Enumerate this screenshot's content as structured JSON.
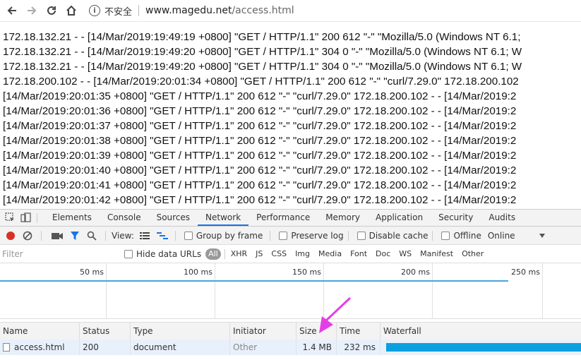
{
  "browser": {
    "security_text": "不安全",
    "url_host": "www.magedu.net",
    "url_path": "/access.html",
    "icons": [
      "back-arrow-icon",
      "forward-arrow-icon",
      "reload-icon",
      "home-icon",
      "info-icon"
    ]
  },
  "page": {
    "log_lines": [
      "172.18.132.21 - - [14/Mar/2019:19:49:19 +0800] \"GET / HTTP/1.1\" 200 612 \"-\" \"Mozilla/5.0 (Windows NT 6.1;",
      "172.18.132.21 - - [14/Mar/2019:19:49:20 +0800] \"GET / HTTP/1.1\" 304 0 \"-\" \"Mozilla/5.0 (Windows NT 6.1; W",
      "172.18.132.21 - - [14/Mar/2019:19:49:20 +0800] \"GET / HTTP/1.1\" 304 0 \"-\" \"Mozilla/5.0 (Windows NT 6.1; W",
      "172.18.200.102 - - [14/Mar/2019:20:01:34 +0800] \"GET / HTTP/1.1\" 200 612 \"-\" \"curl/7.29.0\" 172.18.200.102",
      "[14/Mar/2019:20:01:35 +0800] \"GET / HTTP/1.1\" 200 612 \"-\" \"curl/7.29.0\" 172.18.200.102 - - [14/Mar/2019:2",
      "[14/Mar/2019:20:01:36 +0800] \"GET / HTTP/1.1\" 200 612 \"-\" \"curl/7.29.0\" 172.18.200.102 - - [14/Mar/2019:2",
      "[14/Mar/2019:20:01:37 +0800] \"GET / HTTP/1.1\" 200 612 \"-\" \"curl/7.29.0\" 172.18.200.102 - - [14/Mar/2019:2",
      "[14/Mar/2019:20:01:38 +0800] \"GET / HTTP/1.1\" 200 612 \"-\" \"curl/7.29.0\" 172.18.200.102 - - [14/Mar/2019:2",
      "[14/Mar/2019:20:01:39 +0800] \"GET / HTTP/1.1\" 200 612 \"-\" \"curl/7.29.0\" 172.18.200.102 - - [14/Mar/2019:2",
      "[14/Mar/2019:20:01:40 +0800] \"GET / HTTP/1.1\" 200 612 \"-\" \"curl/7.29.0\" 172.18.200.102 - - [14/Mar/2019:2",
      "[14/Mar/2019:20:01:41 +0800] \"GET / HTTP/1.1\" 200 612 \"-\" \"curl/7.29.0\" 172.18.200.102 - - [14/Mar/2019:2",
      "[14/Mar/2019:20:01:42 +0800] \"GET / HTTP/1.1\" 200 612 \"-\" \"curl/7.29.0\" 172.18.200.102 - - [14/Mar/2019:2"
    ]
  },
  "devtools": {
    "tabs": [
      "Elements",
      "Console",
      "Sources",
      "Network",
      "Performance",
      "Memory",
      "Application",
      "Security",
      "Audits"
    ],
    "active_tab": "Network",
    "toolbar": {
      "view_label": "View:",
      "group_by_frame": "Group by frame",
      "preserve_log": "Preserve log",
      "disable_cache": "Disable cache",
      "offline": "Offline",
      "throttle_value": "Online"
    },
    "filter": {
      "placeholder": "Filter",
      "hide_data_urls": "Hide data URLs",
      "types": [
        "All",
        "XHR",
        "JS",
        "CSS",
        "Img",
        "Media",
        "Font",
        "Doc",
        "WS",
        "Manifest",
        "Other"
      ],
      "active_type": "All"
    },
    "timeline_ticks": [
      "50 ms",
      "100 ms",
      "150 ms",
      "200 ms",
      "250 ms"
    ],
    "columns": [
      "Name",
      "Status",
      "Type",
      "Initiator",
      "Size",
      "Time",
      "Waterfall"
    ],
    "rows": [
      {
        "name": "access.html",
        "status": "200",
        "type": "document",
        "initiator": "Other",
        "size": "1.4 MB",
        "time": "232 ms"
      }
    ],
    "colors": {
      "accent": "#1a73e8",
      "record": "#d93025",
      "waterfall": "#0aa0e0",
      "annotation_arrow": "#e63ee6"
    }
  }
}
